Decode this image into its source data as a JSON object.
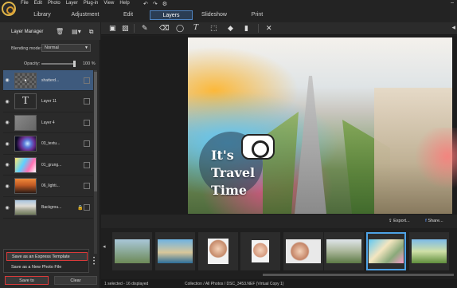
{
  "menu": [
    "File",
    "Edit",
    "Photo",
    "Layer",
    "Plug-in",
    "View",
    "Help"
  ],
  "mode_tabs": [
    {
      "label": "Library"
    },
    {
      "label": "Adjustment"
    },
    {
      "label": "Edit"
    },
    {
      "label": "Layers",
      "active": true
    },
    {
      "label": "Slideshow"
    },
    {
      "label": "Print"
    }
  ],
  "layer_manager": {
    "title": "Layer Manager",
    "blending_label": "Blending mode:",
    "blending_value": "Normal",
    "opacity_label": "Opacity:",
    "opacity_value": "100 %",
    "opacity_level": 1.0,
    "layers": [
      {
        "name": "shatterd...",
        "thumb": "checker",
        "selected": true
      },
      {
        "name": "Layer 11",
        "thumb": "text"
      },
      {
        "name": "Layer 4",
        "thumb": "grey"
      },
      {
        "name": "03_textu...",
        "thumb": "galaxy"
      },
      {
        "name": "01_grung...",
        "thumb": "splash"
      },
      {
        "name": "06_lighti...",
        "thumb": "sunset"
      },
      {
        "name": "Backgrou...",
        "thumb": "city",
        "locked": true
      }
    ]
  },
  "save_menu": {
    "item1": "Save as an Express Template",
    "item2": "Save as a New Photo File"
  },
  "buttons": {
    "save_to": "Save to",
    "clear": "Clear",
    "export": "Export...",
    "share": "Share..."
  },
  "canvas": {
    "title_lines": [
      "It's",
      "Travel",
      "Time"
    ]
  },
  "status": {
    "selection": "1 selected - 16 displayed",
    "path": "Collection / All Photos / DSC_3453.NEF (Virtual Copy 1)"
  },
  "colors": {
    "accent": "#4e83c0",
    "selection": "#3e5a7d",
    "highlight_border": "#d93a3a",
    "film_select": "#4ea3e6"
  }
}
